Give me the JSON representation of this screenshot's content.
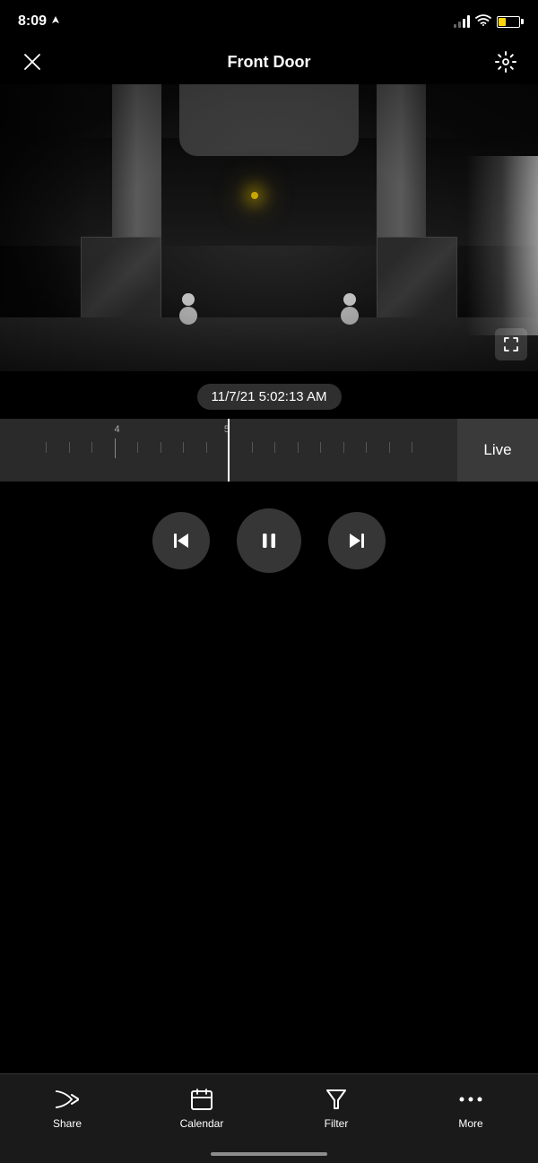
{
  "status_bar": {
    "time": "8:09",
    "location_icon": "▶",
    "signal": "signal-icon",
    "wifi": "wifi-icon",
    "battery": "battery-icon"
  },
  "header": {
    "title": "Front Door",
    "close_label": "close",
    "settings_label": "settings"
  },
  "video": {
    "fullscreen_label": "fullscreen"
  },
  "timestamp": {
    "value": "11/7/21 5:02:13 AM"
  },
  "timeline": {
    "label_4": "4",
    "label_5": "5",
    "live_label": "Live"
  },
  "controls": {
    "skip_back_label": "skip-back",
    "pause_label": "pause",
    "skip_forward_label": "skip-forward"
  },
  "bottom_nav": {
    "items": [
      {
        "id": "share",
        "label": "Share",
        "icon": "share-icon"
      },
      {
        "id": "calendar",
        "label": "Calendar",
        "icon": "calendar-icon"
      },
      {
        "id": "filter",
        "label": "Filter",
        "icon": "filter-icon"
      },
      {
        "id": "more",
        "label": "More",
        "icon": "more-icon"
      }
    ]
  }
}
